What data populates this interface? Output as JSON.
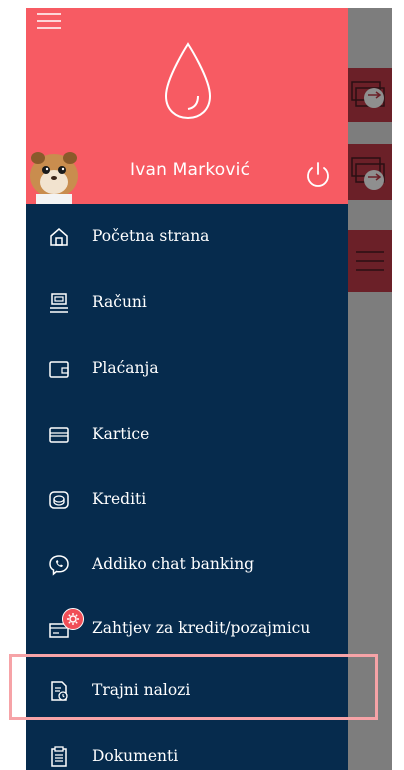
{
  "user": {
    "name": "Ivan Marković"
  },
  "menu": {
    "items": [
      {
        "label": "Početna strana",
        "icon": "home-icon"
      },
      {
        "label": "Računi",
        "icon": "accounts-icon"
      },
      {
        "label": "Plaćanja",
        "icon": "wallet-icon"
      },
      {
        "label": "Kartice",
        "icon": "card-icon"
      },
      {
        "label": "Krediti",
        "icon": "coins-icon"
      },
      {
        "label": "Addiko chat banking",
        "icon": "viber-icon"
      },
      {
        "label": "Zahtjev za kredit/pozajmicu",
        "icon": "loan-request-icon"
      },
      {
        "label": "Trajni nalozi",
        "icon": "standing-order-icon"
      },
      {
        "label": "Dokumenti",
        "icon": "documents-icon"
      }
    ]
  },
  "colors": {
    "header": "#f75b63",
    "drawer": "#062b4d",
    "highlight": "#f6a3a7"
  }
}
